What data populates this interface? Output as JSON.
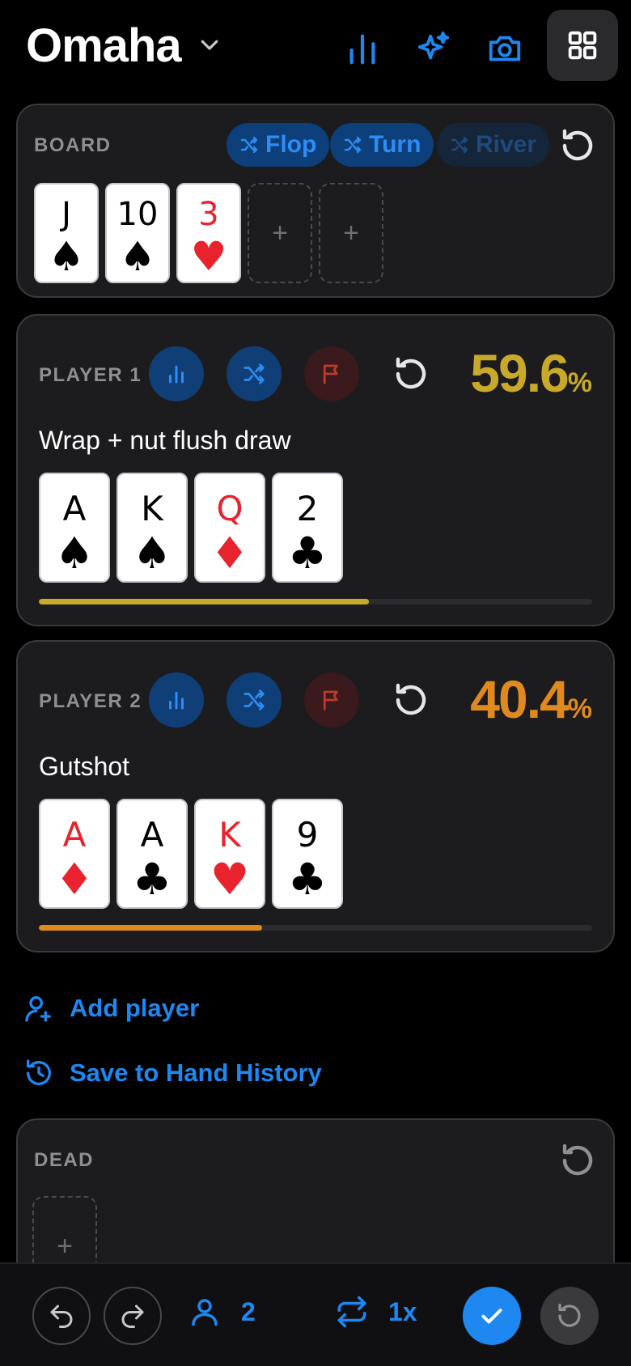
{
  "header": {
    "title": "Omaha",
    "icons": [
      "chevron-down-icon",
      "bar-chart-icon",
      "sparkles-icon",
      "camera-icon",
      "grid-icon"
    ]
  },
  "board": {
    "label": "BOARD",
    "streets": [
      {
        "label": "Flop",
        "enabled": true
      },
      {
        "label": "Turn",
        "enabled": true
      },
      {
        "label": "River",
        "enabled": false
      }
    ],
    "cards": [
      {
        "rank": "J",
        "suit": "♠",
        "color": "black"
      },
      {
        "rank": "10",
        "suit": "♠",
        "color": "black"
      },
      {
        "rank": "3",
        "suit": "♥",
        "color": "red"
      }
    ],
    "empty_slot": "+"
  },
  "players": [
    {
      "label": "PLAYER 1",
      "equity": "59.6",
      "pct_sign": "%",
      "equity_fraction": 0.596,
      "color": "#c8a92a",
      "description": "Wrap + nut flush draw",
      "cards": [
        {
          "rank": "A",
          "suit": "♠",
          "color": "black"
        },
        {
          "rank": "K",
          "suit": "♠",
          "color": "black"
        },
        {
          "rank": "Q",
          "suit": "♦",
          "color": "red"
        },
        {
          "rank": "2",
          "suit": "♣",
          "color": "black"
        }
      ]
    },
    {
      "label": "PLAYER 2",
      "equity": "40.4",
      "pct_sign": "%",
      "equity_fraction": 0.404,
      "color": "#e08a1e",
      "description": "Gutshot",
      "cards": [
        {
          "rank": "A",
          "suit": "♦",
          "color": "red"
        },
        {
          "rank": "A",
          "suit": "♣",
          "color": "black"
        },
        {
          "rank": "K",
          "suit": "♥",
          "color": "red"
        },
        {
          "rank": "9",
          "suit": "♣",
          "color": "black"
        }
      ]
    }
  ],
  "actions": {
    "add_player": "Add player",
    "save_history": "Save to Hand History"
  },
  "dead": {
    "label": "DEAD",
    "empty_slot": "+"
  },
  "bottom_bar": {
    "players_count": "2",
    "runs": "1x"
  },
  "colors": {
    "accent": "#1e88f0",
    "panel": "#1c1c1e"
  }
}
